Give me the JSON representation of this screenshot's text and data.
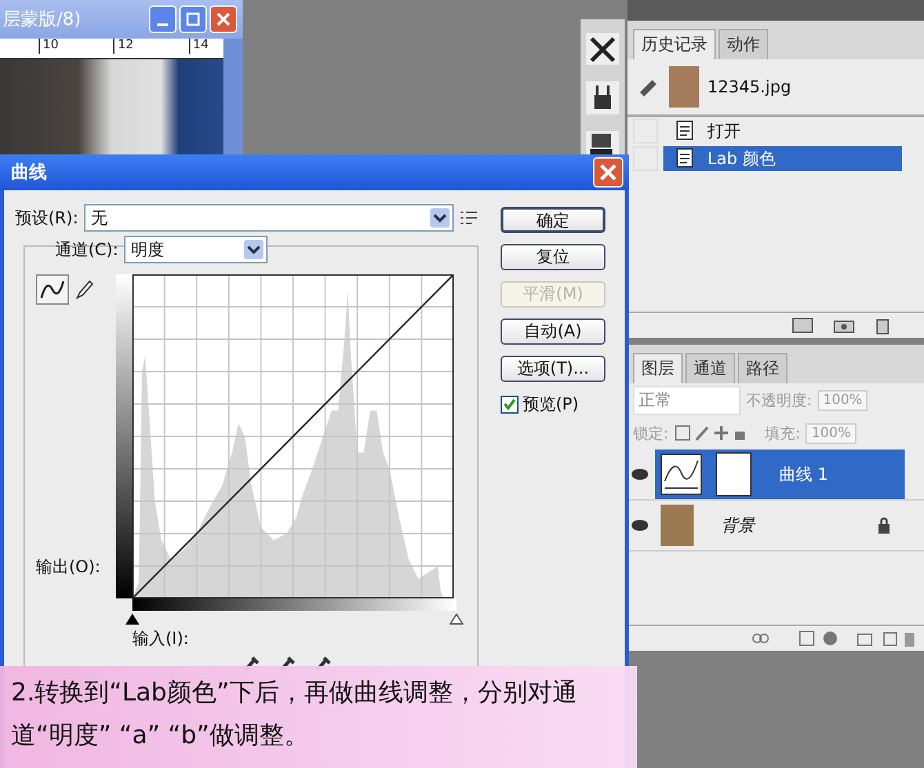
{
  "document_window": {
    "title": "层蒙版/8)",
    "ruler_marks": [
      "10",
      "12",
      "14"
    ]
  },
  "history_panel": {
    "tabs": [
      {
        "label": "历史记录",
        "selected": true
      },
      {
        "label": "动作",
        "selected": false
      }
    ],
    "snapshot": "12345.jpg",
    "items": [
      {
        "label": "打开",
        "selected": false
      },
      {
        "label": "Lab 颜色",
        "selected": true
      }
    ]
  },
  "layers_panel": {
    "tabs": [
      {
        "label": "图层",
        "selected": true
      },
      {
        "label": "通道",
        "selected": false
      },
      {
        "label": "路径",
        "selected": false
      }
    ],
    "blend_mode": "正常",
    "opacity": {
      "label": "不透明度:",
      "value": "100%"
    },
    "lock_label": "锁定:",
    "fill": {
      "label": "填充:",
      "value": "100%"
    },
    "layers": [
      {
        "name": "曲线 1",
        "kind": "adjustment",
        "selected": true,
        "locked": false
      },
      {
        "name": "背景",
        "kind": "image",
        "selected": false,
        "locked": true
      }
    ]
  },
  "curves_dialog": {
    "title": "曲线",
    "preset": {
      "label": "预设(R):",
      "value": "无"
    },
    "channel": {
      "label": "通道(C):",
      "value": "明度"
    },
    "output_label": "输出(O):",
    "input_label": "输入(I):",
    "input_sliders": [
      {
        "kind": "shadow",
        "level": 0
      },
      {
        "kind": "highlight",
        "level": 1
      }
    ],
    "buttons": [
      {
        "label": "确定",
        "default": true,
        "disabled": false
      },
      {
        "label": "复位",
        "default": false,
        "disabled": false
      },
      {
        "label": "平滑(M)",
        "default": false,
        "disabled": true
      },
      {
        "label": "自动(A)",
        "default": false,
        "disabled": false
      },
      {
        "label": "选项(T)...",
        "default": false,
        "disabled": false
      }
    ],
    "preview": {
      "label": "预览(P)",
      "checked": true
    }
  },
  "caption": "2.转换到“Lab颜色”下后，再做曲线调整，分别对通道“明度” “a” “b”做调整。"
}
